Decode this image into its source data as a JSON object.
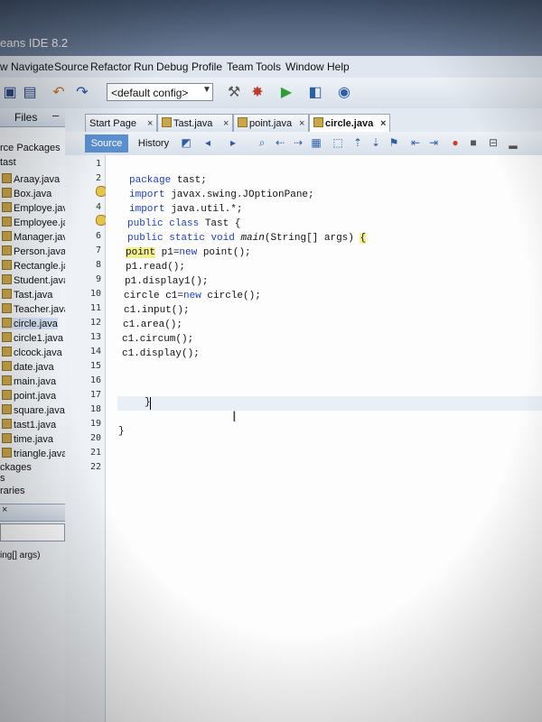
{
  "window": {
    "title": "eans IDE 8.2"
  },
  "menu": [
    "w",
    "Navigate",
    "Source",
    "Refactor",
    "Run",
    "Debug",
    "Profile",
    "Team",
    "Tools",
    "Window",
    "Help"
  ],
  "toolbar": {
    "config": "<default config>"
  },
  "files_panel": {
    "title": "Files",
    "tree": [
      "rce Packages",
      "tast",
      "Araay.java",
      "Box.java",
      "Employe.java",
      "Employee.java",
      "Manager.java",
      "Person.java",
      "Rectangle.java",
      "Student.java",
      "Tast.java",
      "Teacher.java",
      "circle.java",
      "circle1.java",
      "clcock.java",
      "date.java",
      "main.java",
      "point.java",
      "square.java",
      "tast1.java",
      "time.java",
      "triangle.java",
      "ckages",
      "s",
      "raries"
    ],
    "navigator_item": "ing[] args)"
  },
  "editor": {
    "tabs": [
      {
        "label": "Start Page",
        "active": false
      },
      {
        "label": "Tast.java",
        "active": false
      },
      {
        "label": "point.java",
        "active": false
      },
      {
        "label": "circle.java",
        "active": true
      }
    ],
    "source_label": "Source",
    "history_label": "History",
    "line_numbers": [
      "1",
      "2",
      "3",
      "4",
      "5",
      "6",
      "7",
      "8",
      "9",
      "10",
      "11",
      "12",
      "13",
      "14",
      "15",
      "16",
      "17",
      "18",
      "19",
      "20",
      "21",
      "22"
    ],
    "code": {
      "l2_kw": "package",
      "l2_rest": " tast;",
      "l3_kw": "import",
      "l3_rest": " javax.swing.JOptionPane;",
      "l4_kw": "import",
      "l4_rest": " java.util.*;",
      "l5_kw1": "public",
      "l5_kw2": "class",
      "l5_rest": " Tast {",
      "l6_kw1": "public",
      "l6_kw2": "static",
      "l6_kw3": "void",
      "l6_method": "main",
      "l6_rest": "(String[] args) ",
      "l6_brace": "{",
      "l7_type": "point",
      "l7_mid": " p1=",
      "l7_kw": "new",
      "l7_rest": " point();",
      "l8": "p1.read();",
      "l9": "p1.display1();",
      "l10_a": "circle c1=",
      "l10_kw": "new",
      "l10_b": " circle();",
      "l11": "c1.input();",
      "l12": "c1.area();",
      "l13": "c1.circum();",
      "l14": "c1.display();",
      "l18": "}",
      "l20": "}"
    }
  }
}
